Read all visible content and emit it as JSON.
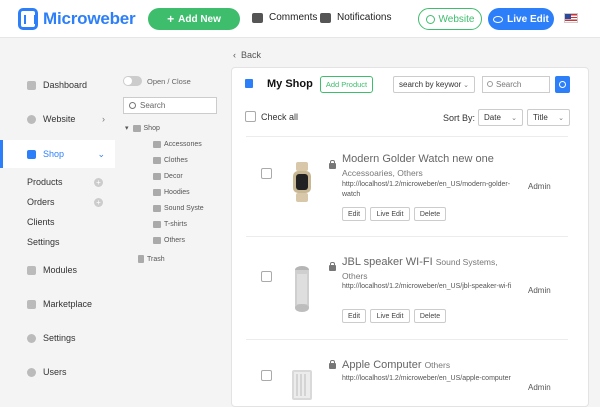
{
  "topbar": {
    "brand": "Microweber",
    "add_new": "Add New",
    "comments": "Comments",
    "notifications": "Notifications",
    "website": "Website",
    "live_edit": "Live Edit"
  },
  "back_label": "Back",
  "sidebar": {
    "items": [
      {
        "label": "Dashboard",
        "icon": "dashboard-icon"
      },
      {
        "label": "Website",
        "icon": "globe-icon"
      },
      {
        "label": "Shop",
        "icon": "shop-icon",
        "active": true
      },
      {
        "label": "Modules",
        "icon": "modules-icon"
      },
      {
        "label": "Marketplace",
        "icon": "marketplace-icon"
      },
      {
        "label": "Settings",
        "icon": "gear-icon"
      },
      {
        "label": "Users",
        "icon": "users-icon"
      }
    ],
    "shop_sub": [
      "Products",
      "Orders",
      "Clients",
      "Settings"
    ]
  },
  "tree": {
    "toggle_label": "Open / Close",
    "search_placeholder": "Search",
    "root": "Shop",
    "categories": [
      "Accessories",
      "Clothes",
      "Decor",
      "Hoodies",
      "Sound Systems",
      "T-shirts",
      "Others"
    ],
    "trash": "Trash"
  },
  "main": {
    "title": "My Shop",
    "add_product": "Add Product",
    "search_by": "search by keywor",
    "search_placeholder": "Search",
    "check_all": "Check all",
    "sort_by": "Sort By:",
    "sort_date": "Date",
    "sort_title": "Title"
  },
  "products": [
    {
      "title": "Modern Golder Watch new one",
      "cats": "Accessoaries, Others",
      "url": "http://localhost/1.2/microweber/en_US/modern-golder-watch",
      "author": "Admin"
    },
    {
      "title": "JBL speaker WI-FI",
      "cats": "Sound Systems, Others",
      "url": "http://localhost/1.2/microweber/en_US/jbl-speaker-wi-fi",
      "author": "Admin"
    },
    {
      "title": "Apple Computer",
      "cats": "Others",
      "url": "http://localhost/1.2/microweber/en_US/apple-computer",
      "author": "Admin"
    }
  ],
  "actions": {
    "edit": "Edit",
    "live_edit": "Live Edit",
    "delete": "Delete"
  },
  "colors": {
    "accent": "#2d7ff9",
    "green": "#3ebd6d"
  }
}
